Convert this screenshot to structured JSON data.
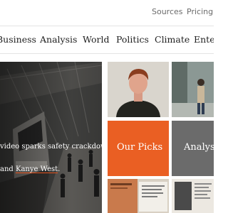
{
  "header": {
    "links": [
      "Sources",
      "Pricing"
    ]
  },
  "nav": {
    "items": [
      "Business",
      "Analysis",
      "World",
      "Politics",
      "Climate",
      "Enter"
    ]
  },
  "hero": {
    "line1": "video sparks safety crackdown",
    "line2_prefix": "and ",
    "line2_link": "Kanye West",
    "line2_suffix": "."
  },
  "tiles": {
    "picks_label": "Our Picks",
    "analysis_label": "Analys"
  },
  "colors": {
    "accent": "#ea5f23",
    "gray_tile": "#6b6b6b",
    "link_underline": "#e8541e"
  }
}
